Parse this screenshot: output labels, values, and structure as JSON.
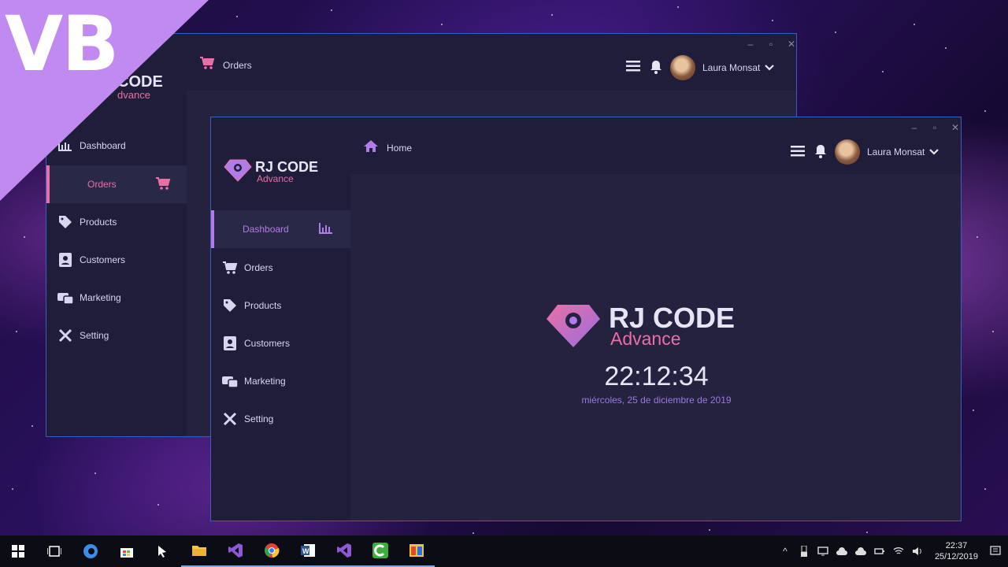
{
  "badge": {
    "text": "VB"
  },
  "back_window": {
    "header_title": "Orders",
    "user_name": "Laura Monsat",
    "logo_line1": "CODE",
    "logo_line2": "dvance",
    "nav": [
      {
        "label": "Dashboard",
        "icon": "bar-chart-icon"
      },
      {
        "label": "Orders",
        "icon": "cart-icon",
        "active": true
      },
      {
        "label": "Products",
        "icon": "tag-icon"
      },
      {
        "label": "Customers",
        "icon": "contact-icon"
      },
      {
        "label": "Marketing",
        "icon": "marketing-icon"
      },
      {
        "label": "Setting",
        "icon": "tools-icon"
      }
    ]
  },
  "front_window": {
    "header_title": "Home",
    "user_name": "Laura Monsat",
    "logo_line1": "RJ CODE",
    "logo_line2": "Advance",
    "nav": [
      {
        "label": "Dashboard",
        "icon": "bar-chart-icon",
        "active": true
      },
      {
        "label": "Orders",
        "icon": "cart-icon"
      },
      {
        "label": "Products",
        "icon": "tag-icon"
      },
      {
        "label": "Customers",
        "icon": "contact-icon"
      },
      {
        "label": "Marketing",
        "icon": "marketing-icon"
      },
      {
        "label": "Setting",
        "icon": "tools-icon"
      }
    ],
    "home": {
      "logo_line1": "RJ CODE",
      "logo_line2": "Advance",
      "time": "22:12:34",
      "date": "miércoles, 25 de diciembre de 2019"
    }
  },
  "taskbar": {
    "apps": [
      "windows-start-icon",
      "task-view-icon",
      "edge-icon",
      "store-icon",
      "cursor-icon",
      "file-explorer-icon",
      "visual-studio-icon",
      "chrome-icon",
      "word-icon",
      "visual-studio-2-icon",
      "camtasia-icon",
      "app-window-icon"
    ],
    "clock_time": "22:37",
    "clock_date": "25/12/2019"
  },
  "colors": {
    "accent_purple": "#b27ce8",
    "accent_pink": "#e96fa6",
    "window_bg": "#24223f",
    "sidebar_bg": "#1f1d3a"
  }
}
